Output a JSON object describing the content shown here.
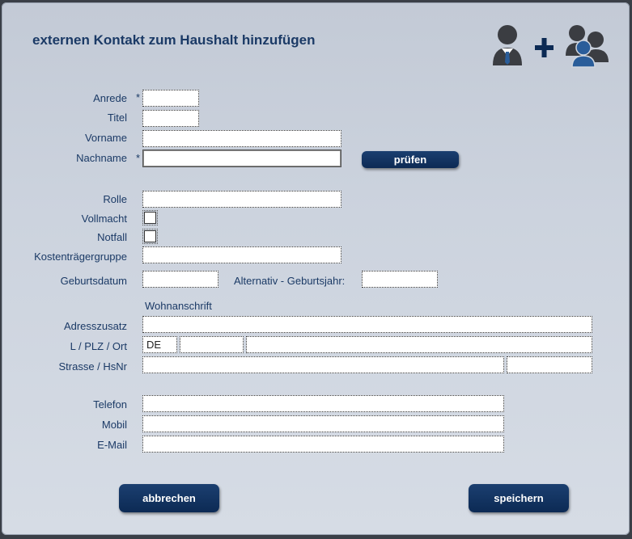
{
  "dialog": {
    "title": "externen Kontakt zum Haushalt hinzufügen"
  },
  "icons": {
    "person": "person-icon",
    "plus": "plus-icon",
    "group": "group-icon"
  },
  "labels": {
    "anrede": "Anrede",
    "titel": "Titel",
    "vorname": "Vorname",
    "nachname": "Nachname",
    "rolle": "Rolle",
    "vollmacht": "Vollmacht",
    "notfall": "Notfall",
    "kostentraegergruppe": "Kostenträgergruppe",
    "geburtsdatum": "Geburtsdatum",
    "alt_geburtsjahr": "Alternativ - Geburtsjahr:",
    "wohnanschrift": "Wohnanschrift",
    "adresszusatz": "Adresszusatz",
    "lplzort": "L / PLZ / Ort",
    "strasse": "Strasse / HsNr",
    "telefon": "Telefon",
    "mobil": "Mobil",
    "email": "E-Mail",
    "required_marker": "*"
  },
  "values": {
    "anrede": "",
    "titel": "",
    "vorname": "",
    "nachname": "",
    "rolle": "",
    "kostentraegergruppe": "",
    "geburtsdatum": "",
    "geburtsjahr": "",
    "adresszusatz": "",
    "land": "DE",
    "plz": "",
    "ort": "",
    "strasse": "",
    "hsnr": "",
    "telefon": "",
    "mobil": "",
    "email": "",
    "vollmacht": false,
    "notfall": false
  },
  "buttons": {
    "pruefen": "prüfen",
    "abbrechen": "abbrechen",
    "speichern": "speichern"
  },
  "colors": {
    "label": "#1b3a66",
    "button": "#0c2a54",
    "icon_dark": "#3b3d42",
    "icon_blue": "#2a5d9a"
  }
}
